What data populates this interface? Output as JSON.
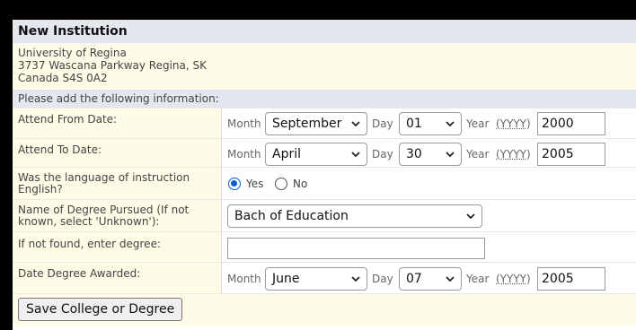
{
  "form": {
    "title": "New Institution",
    "address": [
      "University of Regina",
      "3737 Wascana Parkway Regina, SK",
      "Canada S4S 0A2"
    ],
    "info_text": "Please add the following information:",
    "labels": {
      "month": "Month",
      "day": "Day",
      "year": "Year",
      "year_format": "(YYYY)"
    },
    "attend_from": {
      "label": "Attend From Date:",
      "month": "September",
      "day": "01",
      "year": "2000"
    },
    "attend_to": {
      "label": "Attend To Date:",
      "month": "April",
      "day": "30",
      "year": "2005"
    },
    "language": {
      "label_line1": "Was the language of instruction",
      "label_line2": "English?",
      "yes": "Yes",
      "no": "No",
      "selected": "Yes"
    },
    "degree": {
      "label_line1": "Name of Degree Pursued (If not",
      "label_line2": "known, select 'Unknown'):",
      "value": "Bach of Education"
    },
    "degree_other": {
      "label": "If not found, enter degree:",
      "value": ""
    },
    "awarded": {
      "label": "Date Degree Awarded:",
      "month": "June",
      "day": "07",
      "year": "2005"
    },
    "save_button": "Save College or Degree"
  }
}
